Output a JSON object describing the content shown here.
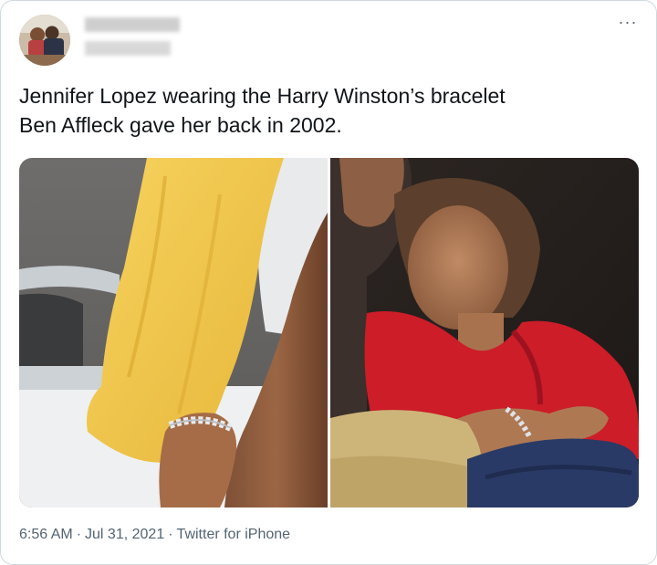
{
  "tweet": {
    "text": "Jennifer Lopez wearing the Harry Winston’s bracelet\nBen Affleck gave her back in 2002.",
    "more_label": "···"
  },
  "meta": {
    "time": "6:56 AM",
    "separator": "·",
    "date": "Jul 31, 2021",
    "source": "Twitter for iPhone"
  },
  "icons": {
    "more": "more-horizontal-icon"
  },
  "colors": {
    "text": "#0f1419",
    "secondary": "#536471",
    "border": "#cfd9de",
    "towel_yellow": "#f2c94c",
    "hoodie_red": "#d11f2a",
    "sweater_blue": "#2a3a66"
  }
}
